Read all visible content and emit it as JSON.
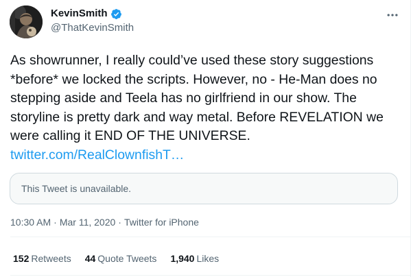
{
  "author": {
    "name": "KevinSmith",
    "handle": "@ThatKevinSmith",
    "verified": true
  },
  "tweet": {
    "text": "As showrunner, I really could’ve used these story suggestions *before* we locked the scripts. However, no - He-Man does no stepping aside and Teela has no girlfriend in our show. The storyline is pretty dark and way metal. Before REVELATION we were calling it END OF THE UNIVERSE.",
    "link": "twitter.com/RealClownfishT…"
  },
  "quote": {
    "text": "This Tweet is unavailable."
  },
  "meta": {
    "time": "10:30 AM",
    "date": "Mar 11, 2020",
    "source": "Twitter for iPhone",
    "separator": "·"
  },
  "stats": {
    "retweets": {
      "value": "152",
      "label": "Retweets"
    },
    "quote_tweets": {
      "value": "44",
      "label": "Quote Tweets"
    },
    "likes": {
      "value": "1,940",
      "label": "Likes"
    }
  },
  "colors": {
    "link": "#1d9bf0",
    "verified": "#1d9bf0",
    "secondary_text": "#536471",
    "primary_text": "#0f1419"
  },
  "icons": {
    "verified": "verified-badge-icon",
    "more": "more-horizontal-icon"
  }
}
